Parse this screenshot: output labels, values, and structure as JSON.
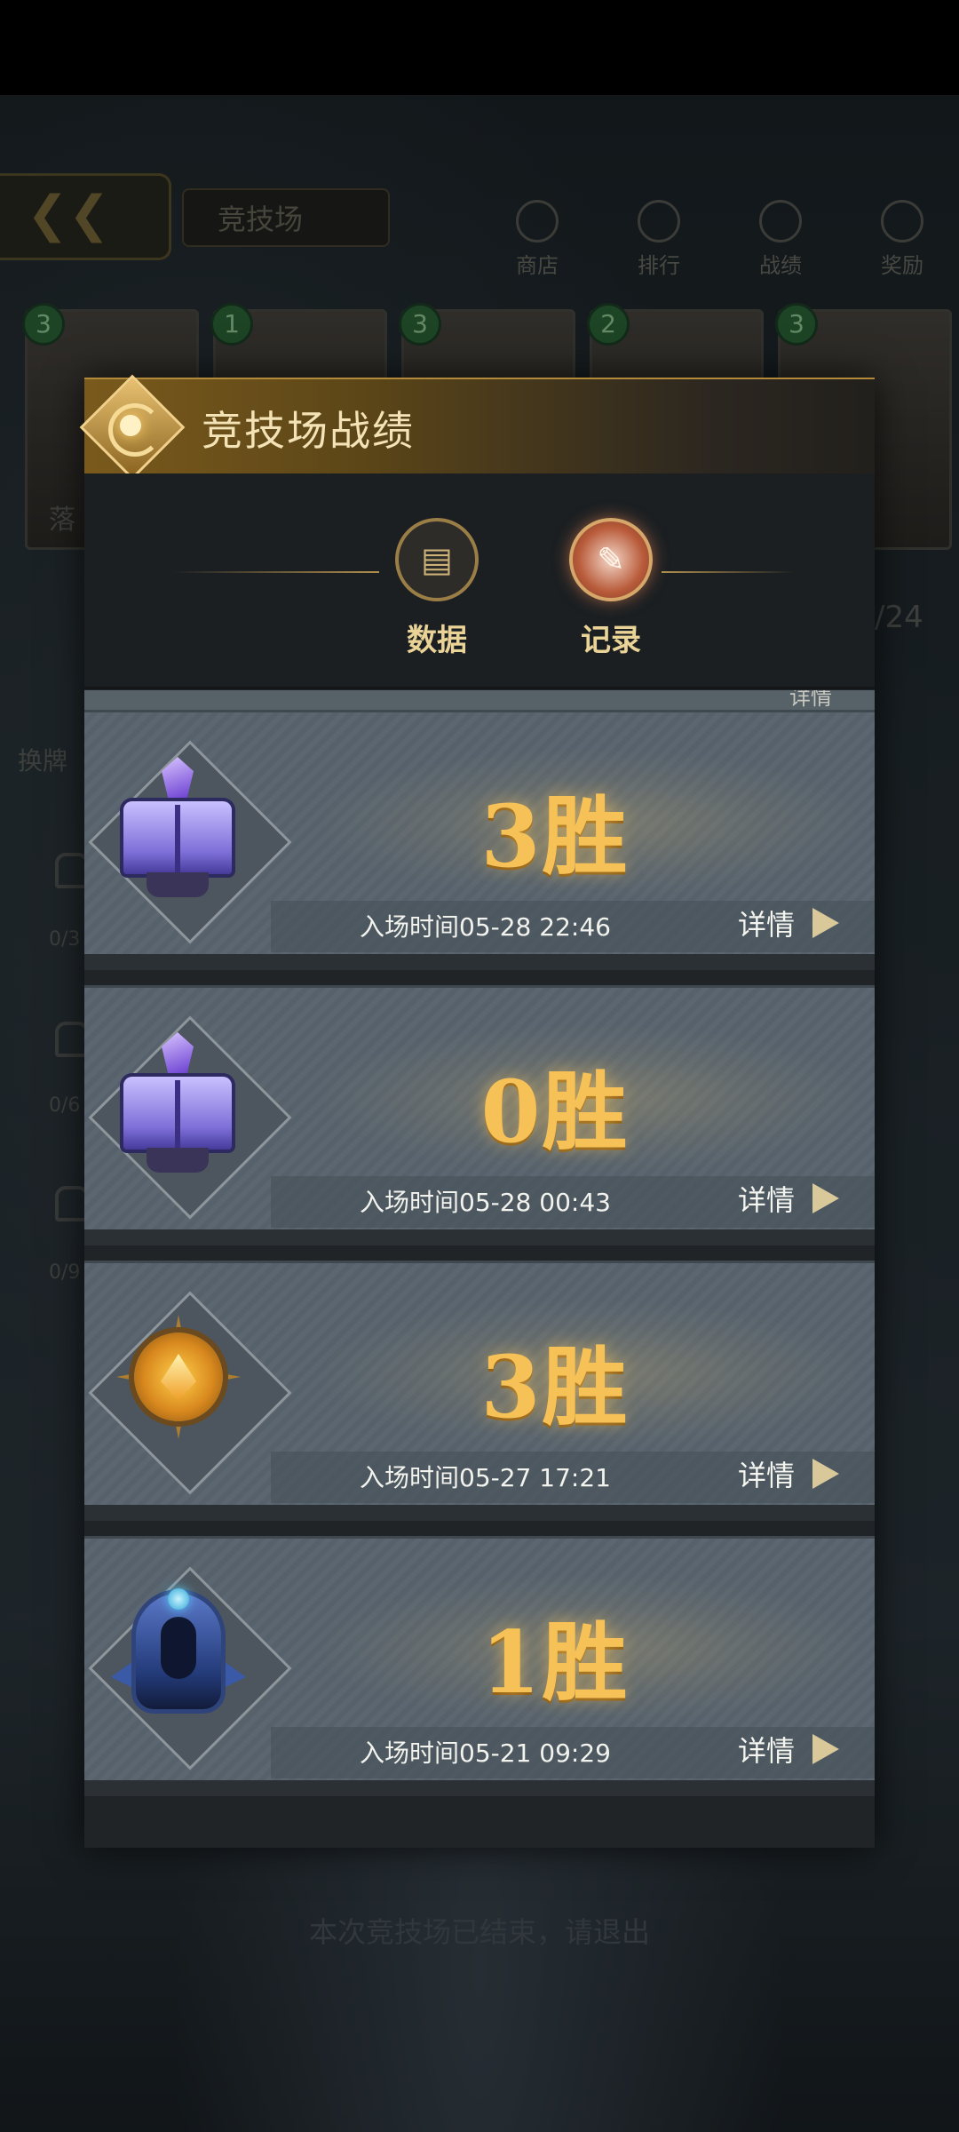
{
  "background": {
    "page_title": "竞技场",
    "nav": [
      "商店",
      "排行",
      "战绩",
      "奖励"
    ],
    "card_costs": [
      "3",
      "1",
      "3",
      "2",
      "3"
    ],
    "card_name_fragment": "落",
    "side_label": "换牌",
    "counter": "/24",
    "progress": [
      "0/3",
      "0/6",
      "0/9"
    ],
    "footer_message": "本次竞技场已结束，请退出"
  },
  "modal": {
    "title": "竞技场战绩",
    "tabs": [
      {
        "label": "数据",
        "icon": "chart-icon"
      },
      {
        "label": "记录",
        "icon": "quill-icon",
        "active": true
      }
    ],
    "peek_detail": "详情",
    "records": [
      {
        "wins": "3胜",
        "time": "入场时间05-28 22:46",
        "detail": "详情",
        "icon": "spellbook-icon"
      },
      {
        "wins": "0胜",
        "time": "入场时间05-28 00:43",
        "detail": "详情",
        "icon": "spellbook-icon"
      },
      {
        "wins": "3胜",
        "time": "入场时间05-27 17:21",
        "detail": "详情",
        "icon": "sun-emblem-icon"
      },
      {
        "wins": "1胜",
        "time": "入场时间05-21 09:29",
        "detail": "详情",
        "icon": "blue-shield-icon"
      }
    ]
  }
}
